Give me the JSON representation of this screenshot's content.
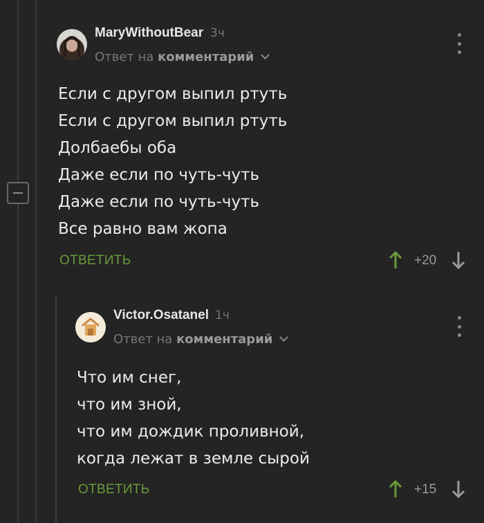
{
  "comments": [
    {
      "username": "MaryWithoutBear",
      "time": "3ч",
      "reply_prefix": "Ответ на",
      "reply_target": "комментарий",
      "lines": [
        "Если с другом выпил ртуть",
        "Если с другом выпил ртуть",
        "Долбаебы оба",
        "Даже если по чуть-чуть",
        "Даже если по чуть-чуть",
        "Все равно вам жопа"
      ],
      "reply_button": "ОТВЕТИТЬ",
      "score": "+20"
    },
    {
      "username": "Victor.Osatanel",
      "time": "1ч",
      "reply_prefix": "Ответ на",
      "reply_target": "комментарий",
      "lines": [
        "Что им снег,",
        "что им зной,",
        "что им дождик проливной,",
        "когда лежат в земле сырой"
      ],
      "reply_button": "ОТВЕТИТЬ",
      "score": "+15"
    }
  ],
  "colors": {
    "background": "#242424",
    "accent_green": "#6a9a3a",
    "muted_text": "#777777"
  },
  "icons": [
    "collapse-icon",
    "menu-dots-icon",
    "upvote-icon",
    "downvote-icon"
  ]
}
